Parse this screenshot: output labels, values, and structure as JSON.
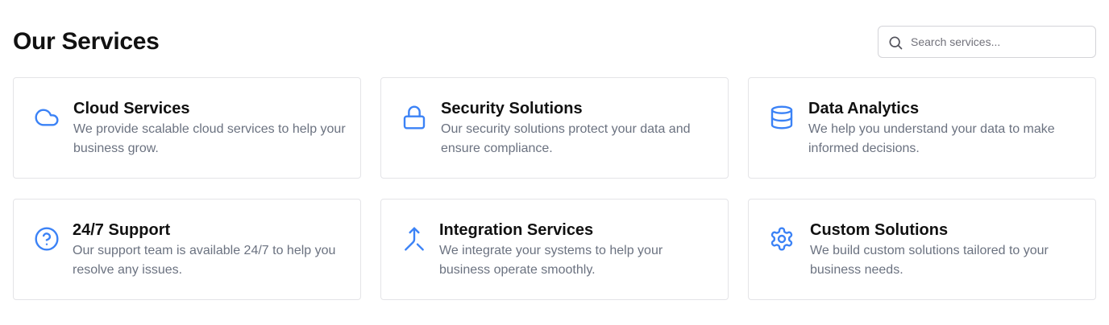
{
  "header": {
    "title": "Our Services",
    "search_placeholder": "Search services..."
  },
  "accent_color": "#3b82f6",
  "services": [
    {
      "title": "Cloud Services",
      "description": "We provide scalable cloud services to help your business grow.",
      "icon": "cloud-icon"
    },
    {
      "title": "Security Solutions",
      "description": "Our security solutions protect your data and ensure compliance.",
      "icon": "lock-icon"
    },
    {
      "title": "Data Analytics",
      "description": "We help you understand your data to make informed decisions.",
      "icon": "database-icon"
    },
    {
      "title": "24/7 Support",
      "description": "Our support team is available 24/7 to help you resolve any issues.",
      "icon": "help-circle-icon"
    },
    {
      "title": "Integration Services",
      "description": "We integrate your systems to help your business operate smoothly.",
      "icon": "merge-icon"
    },
    {
      "title": "Custom Solutions",
      "description": "We build custom solutions tailored to your business needs.",
      "icon": "gear-icon"
    }
  ]
}
